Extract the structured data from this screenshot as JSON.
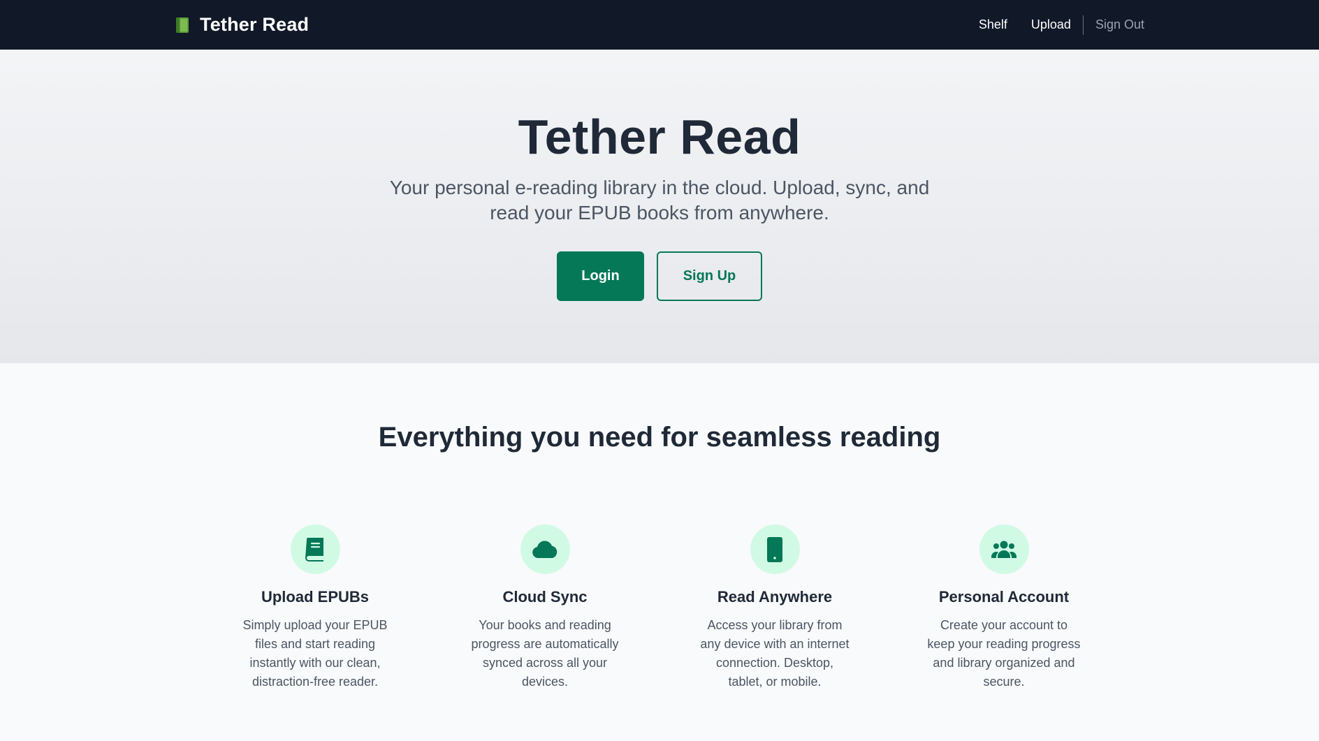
{
  "nav": {
    "brand": "Tether Read",
    "links": {
      "shelf": "Shelf",
      "upload": "Upload",
      "sign_out": "Sign Out"
    }
  },
  "hero": {
    "title": "Tether Read",
    "subtitle": "Your personal e-reading library in the cloud. Upload, sync, and read your EPUB books from anywhere.",
    "login_label": "Login",
    "signup_label": "Sign Up"
  },
  "features": {
    "heading": "Everything you need for seamless reading",
    "items": [
      {
        "icon": "book-icon",
        "title": "Upload EPUBs",
        "description": "Simply upload your EPUB files and start reading instantly with our clean, distraction-free reader."
      },
      {
        "icon": "cloud-icon",
        "title": "Cloud Sync",
        "description": "Your books and reading progress are automatically synced across all your devices."
      },
      {
        "icon": "mobile-icon",
        "title": "Read Anywhere",
        "description": "Access your library from any device with an internet connection. Desktop, tablet, or mobile."
      },
      {
        "icon": "users-icon",
        "title": "Personal Account",
        "description": "Create your account to keep your reading progress and library organized and secure."
      }
    ]
  },
  "colors": {
    "nav_bg": "#111827",
    "accent": "#047857",
    "icon_bg": "#d1fae5"
  }
}
